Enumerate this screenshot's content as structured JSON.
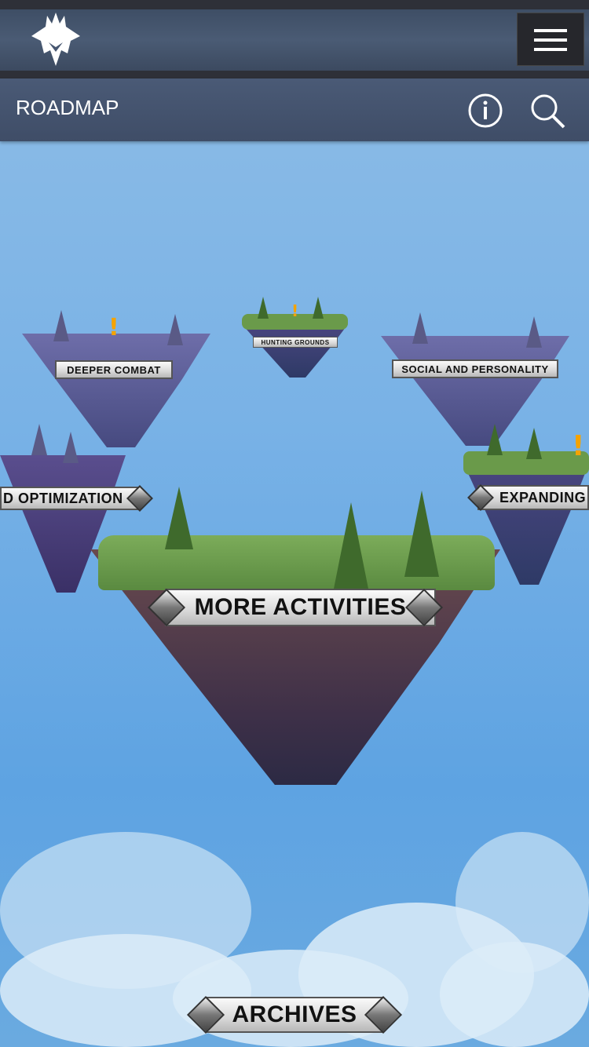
{
  "header": {
    "logo": "game-logo",
    "menu_icon": "hamburger-menu-icon"
  },
  "subheader": {
    "title": "ROADMAP",
    "info_icon": "info-icon",
    "search_icon": "search-icon"
  },
  "islands": {
    "deeper_combat": {
      "label": "DEEPER COMBAT",
      "alert": "!"
    },
    "hunting_grounds": {
      "label": "HUNTING GROUNDS",
      "alert": "!"
    },
    "social": {
      "label": "SOCIAL AND PERSONALITY"
    },
    "optimization": {
      "label": "D OPTIMIZATION"
    },
    "expanding": {
      "label": "EXPANDING U",
      "alert": "!"
    },
    "more_activities": {
      "label": "MORE ACTIVITIES"
    }
  },
  "archives": {
    "label": "ARCHIVES"
  },
  "colors": {
    "alert": "#f5a300",
    "header": "#465670"
  }
}
